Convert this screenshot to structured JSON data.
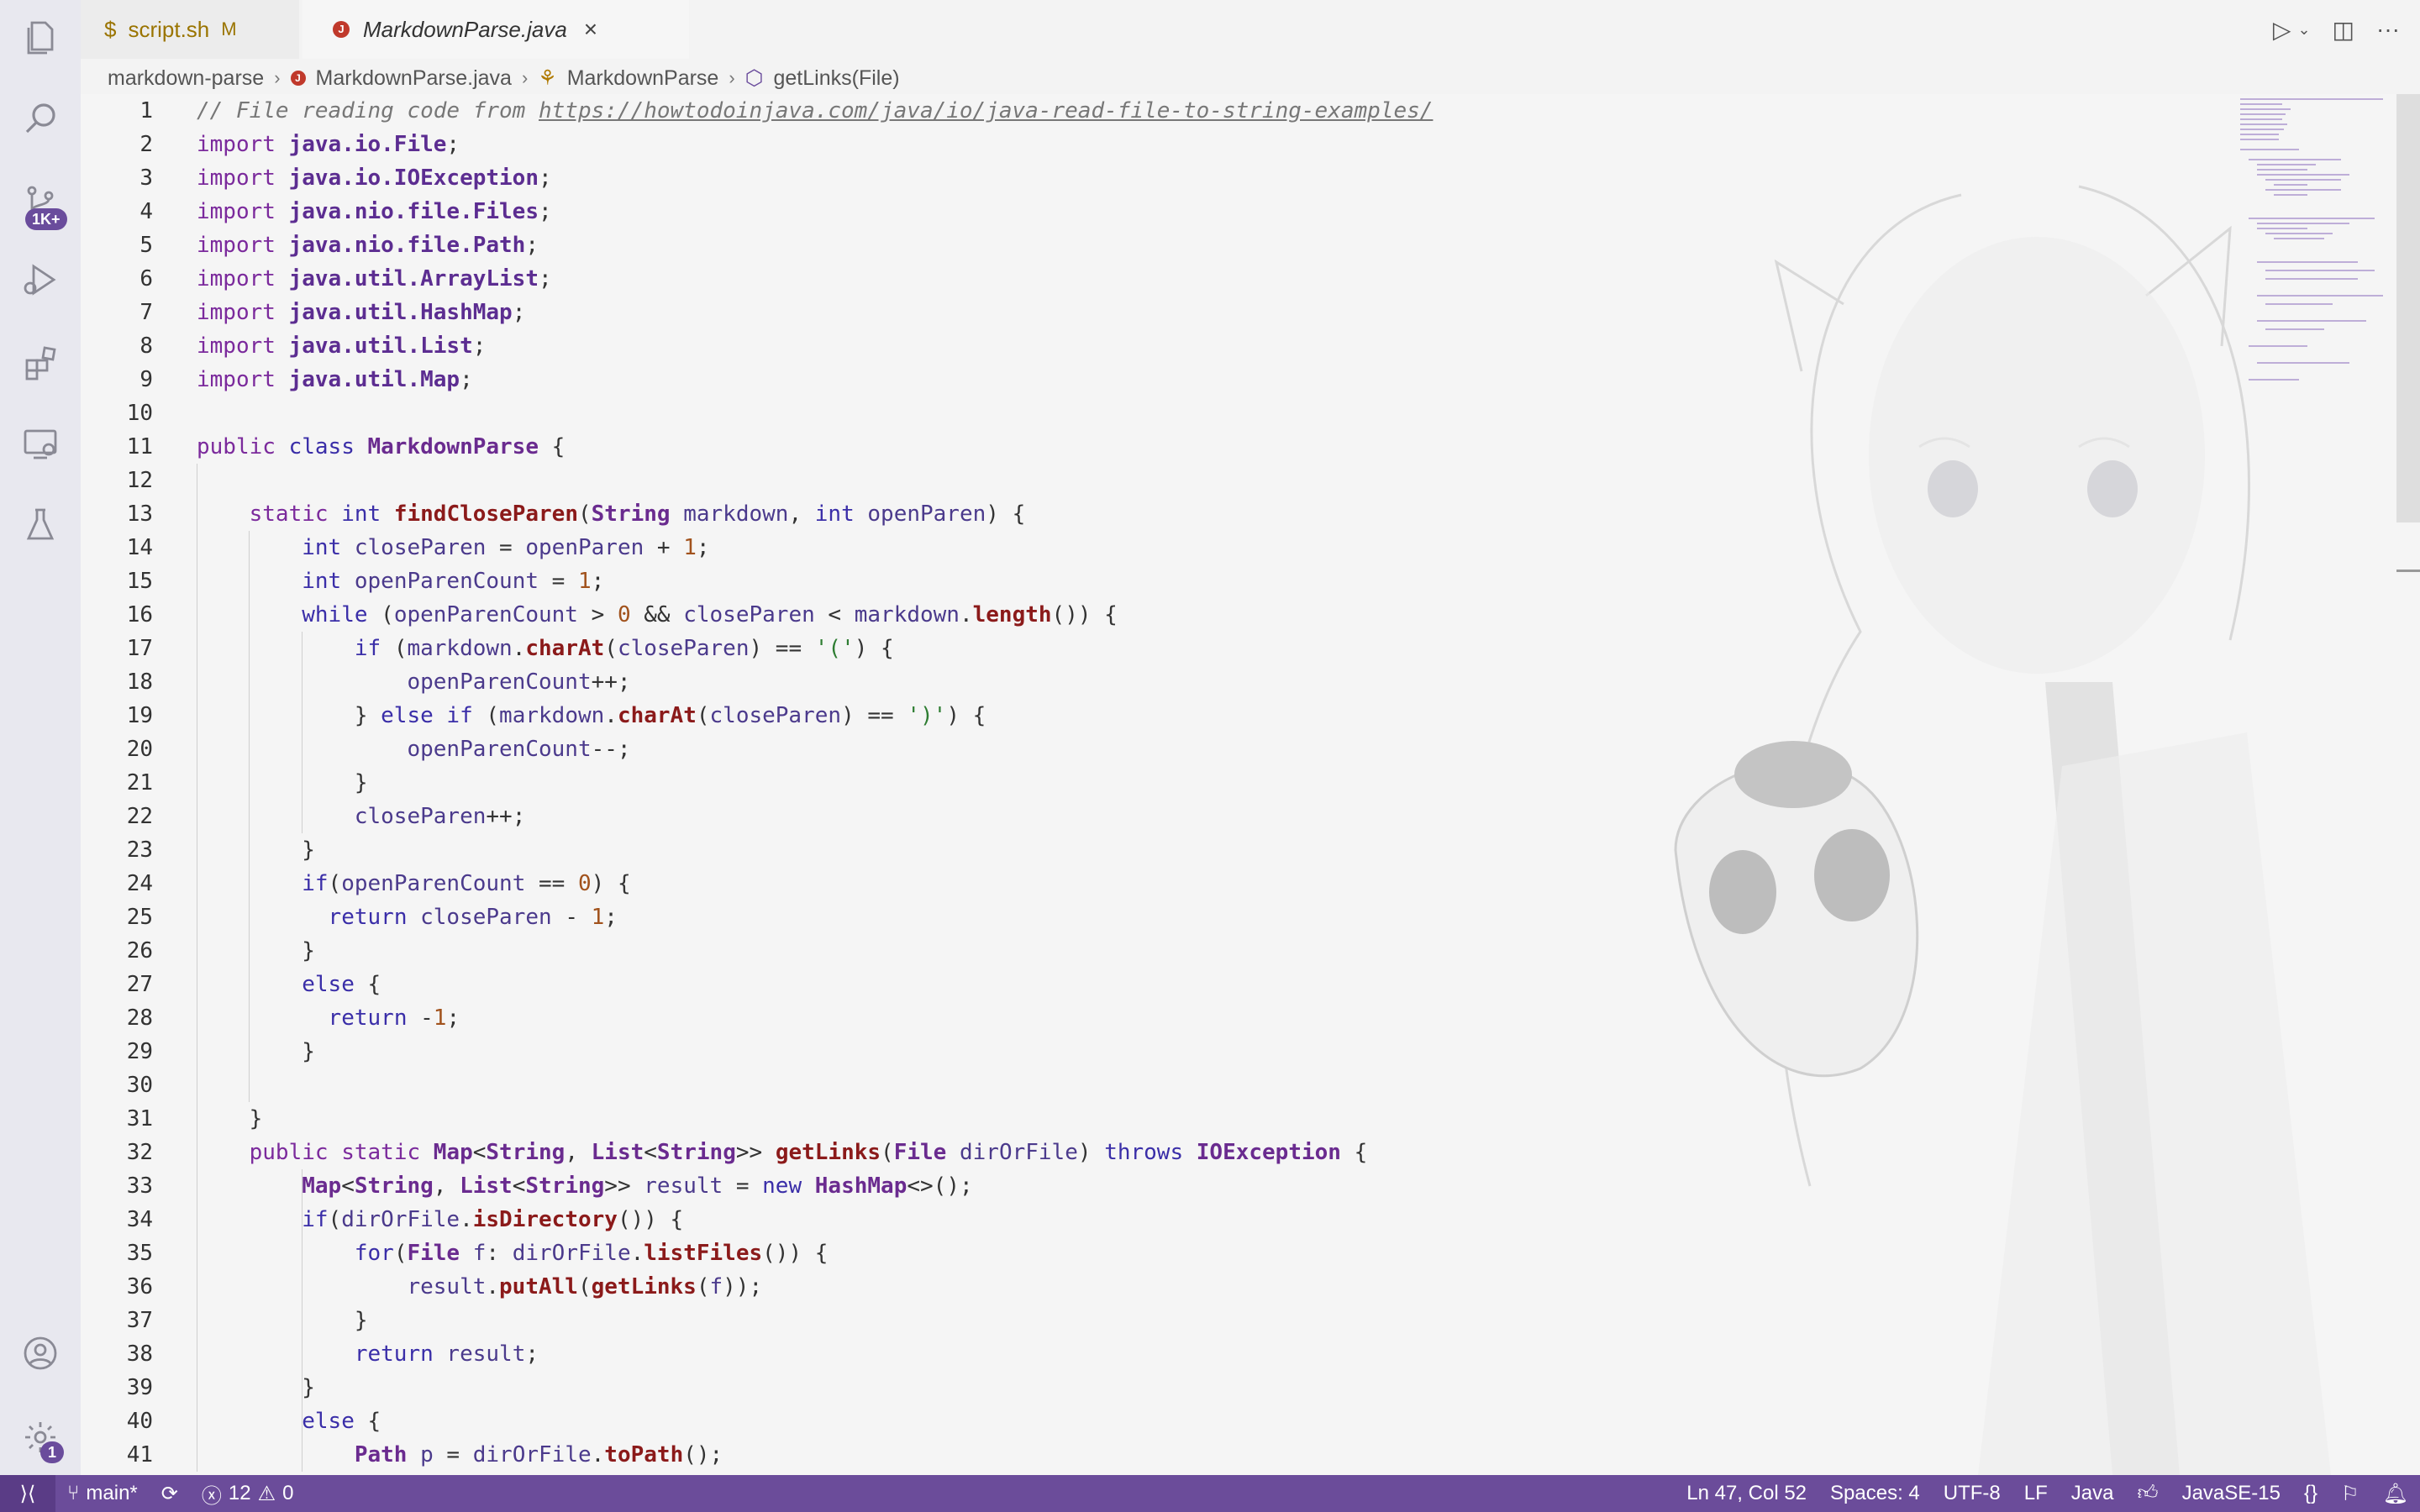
{
  "activity_bar": {
    "items": [
      {
        "name": "explorer-icon"
      },
      {
        "name": "search-icon"
      },
      {
        "name": "source-control-icon",
        "badge": "1K+"
      },
      {
        "name": "run-debug-icon"
      },
      {
        "name": "extensions-icon"
      },
      {
        "name": "remote-explorer-icon"
      },
      {
        "name": "testing-icon"
      }
    ],
    "bottom": [
      {
        "name": "accounts-icon"
      },
      {
        "name": "manage-gear-icon",
        "badge": "1"
      }
    ]
  },
  "tabs": [
    {
      "glyph": "$",
      "label": "script.sh",
      "modified": "M",
      "active": false
    },
    {
      "glyph": "J",
      "label": "MarkdownParse.java",
      "active": true
    }
  ],
  "breadcrumb": [
    "markdown-parse",
    "MarkdownParse.java",
    "MarkdownParse",
    "getLinks(File)"
  ],
  "code": {
    "start_line": 1,
    "lines": [
      [
        [
          "cm",
          "// File reading code from "
        ],
        [
          "cm lnk",
          "https://howtodoinjava.com/java/io/java-read-file-to-string-examples/"
        ]
      ],
      [
        [
          "kw2",
          "import "
        ],
        [
          "pkg",
          "java.io.File"
        ],
        [
          "",
          "; "
        ]
      ],
      [
        [
          "kw2",
          "import "
        ],
        [
          "pkg",
          "java.io.IOException"
        ],
        [
          "",
          ";"
        ]
      ],
      [
        [
          "kw2",
          "import "
        ],
        [
          "pkg",
          "java.nio.file.Files"
        ],
        [
          "",
          ";"
        ]
      ],
      [
        [
          "kw2",
          "import "
        ],
        [
          "pkg",
          "java.nio.file.Path"
        ],
        [
          "",
          ";"
        ]
      ],
      [
        [
          "kw2",
          "import "
        ],
        [
          "pkg",
          "java.util.ArrayList"
        ],
        [
          "",
          ";"
        ]
      ],
      [
        [
          "kw2",
          "import "
        ],
        [
          "pkg",
          "java.util.HashMap"
        ],
        [
          "",
          ";"
        ]
      ],
      [
        [
          "kw2",
          "import "
        ],
        [
          "pkg",
          "java.util.List"
        ],
        [
          "",
          ";"
        ]
      ],
      [
        [
          "kw2",
          "import "
        ],
        [
          "pkg",
          "java.util.Map"
        ],
        [
          "",
          ";"
        ]
      ],
      [],
      [
        [
          "kw2",
          "public "
        ],
        [
          "kw",
          "class "
        ],
        [
          "ty",
          "MarkdownParse"
        ],
        [
          "",
          " {"
        ]
      ],
      [],
      [
        [
          "",
          "    "
        ],
        [
          "kw2",
          "static "
        ],
        [
          "kw",
          "int "
        ],
        [
          "fn",
          "findCloseParen"
        ],
        [
          "",
          "("
        ],
        [
          "ty",
          "String"
        ],
        [
          "var",
          " markdown"
        ],
        [
          "",
          ", "
        ],
        [
          "kw",
          "int "
        ],
        [
          "var",
          "openParen"
        ],
        [
          "",
          ") {"
        ]
      ],
      [
        [
          "",
          "        "
        ],
        [
          "kw",
          "int "
        ],
        [
          "var",
          "closeParen"
        ],
        [
          "",
          " = "
        ],
        [
          "var",
          "openParen"
        ],
        [
          "",
          " + "
        ],
        [
          "num",
          "1"
        ],
        [
          "",
          ";"
        ]
      ],
      [
        [
          "",
          "        "
        ],
        [
          "kw",
          "int "
        ],
        [
          "var",
          "openParenCount"
        ],
        [
          "",
          " = "
        ],
        [
          "num",
          "1"
        ],
        [
          "",
          ";"
        ]
      ],
      [
        [
          "",
          "        "
        ],
        [
          "kw",
          "while "
        ],
        [
          "",
          "("
        ],
        [
          "var",
          "openParenCount"
        ],
        [
          "",
          " > "
        ],
        [
          "num",
          "0"
        ],
        [
          "",
          " && "
        ],
        [
          "var",
          "closeParen"
        ],
        [
          "",
          " < "
        ],
        [
          "var",
          "markdown"
        ],
        [
          "",
          "."
        ],
        [
          "fn",
          "length"
        ],
        [
          "",
          "()) {"
        ]
      ],
      [
        [
          "",
          "            "
        ],
        [
          "kw",
          "if "
        ],
        [
          "",
          "("
        ],
        [
          "var",
          "markdown"
        ],
        [
          "",
          "."
        ],
        [
          "fn",
          "charAt"
        ],
        [
          "",
          "("
        ],
        [
          "var",
          "closeParen"
        ],
        [
          "",
          ") == "
        ],
        [
          "str",
          "'('"
        ],
        [
          "",
          ") {"
        ]
      ],
      [
        [
          "",
          "                "
        ],
        [
          "var",
          "openParenCount"
        ],
        [
          "",
          "++;"
        ]
      ],
      [
        [
          "",
          "            } "
        ],
        [
          "kw",
          "else if "
        ],
        [
          "",
          "("
        ],
        [
          "var",
          "markdown"
        ],
        [
          "",
          "."
        ],
        [
          "fn",
          "charAt"
        ],
        [
          "",
          "("
        ],
        [
          "var",
          "closeParen"
        ],
        [
          "",
          ") == "
        ],
        [
          "str",
          "')'"
        ],
        [
          "",
          ") {"
        ]
      ],
      [
        [
          "",
          "                "
        ],
        [
          "var",
          "openParenCount"
        ],
        [
          "",
          "--;"
        ]
      ],
      [
        [
          "",
          "            }"
        ]
      ],
      [
        [
          "",
          "            "
        ],
        [
          "var",
          "closeParen"
        ],
        [
          "",
          "++;"
        ]
      ],
      [
        [
          "",
          "        }"
        ]
      ],
      [
        [
          "",
          "        "
        ],
        [
          "kw",
          "if"
        ],
        [
          "",
          "("
        ],
        [
          "var",
          "openParenCount"
        ],
        [
          "",
          " == "
        ],
        [
          "num",
          "0"
        ],
        [
          "",
          ") {"
        ]
      ],
      [
        [
          "",
          "          "
        ],
        [
          "kw",
          "return "
        ],
        [
          "var",
          "closeParen"
        ],
        [
          "",
          " - "
        ],
        [
          "num",
          "1"
        ],
        [
          "",
          ";"
        ]
      ],
      [
        [
          "",
          "        }"
        ]
      ],
      [
        [
          "",
          "        "
        ],
        [
          "kw",
          "else "
        ],
        [
          "",
          "{"
        ]
      ],
      [
        [
          "",
          "          "
        ],
        [
          "kw",
          "return "
        ],
        [
          "",
          "-"
        ],
        [
          "num",
          "1"
        ],
        [
          "",
          ";"
        ]
      ],
      [
        [
          "",
          "        }"
        ]
      ],
      [],
      [
        [
          "",
          "    }"
        ]
      ],
      [
        [
          "",
          "    "
        ],
        [
          "kw2",
          "public "
        ],
        [
          "kw2",
          "static "
        ],
        [
          "ty",
          "Map"
        ],
        [
          "",
          "<"
        ],
        [
          "ty",
          "String"
        ],
        [
          "",
          ", "
        ],
        [
          "ty",
          "List"
        ],
        [
          "",
          "<"
        ],
        [
          "ty",
          "String"
        ],
        [
          "",
          ">> "
        ],
        [
          "fn",
          "getLinks"
        ],
        [
          "",
          "("
        ],
        [
          "ty",
          "File"
        ],
        [
          "var",
          " dirOrFile"
        ],
        [
          "",
          ") "
        ],
        [
          "kw",
          "throws "
        ],
        [
          "ty",
          "IOException"
        ],
        [
          "",
          " {"
        ]
      ],
      [
        [
          "",
          "        "
        ],
        [
          "ty",
          "Map"
        ],
        [
          "",
          "<"
        ],
        [
          "ty",
          "String"
        ],
        [
          "",
          ", "
        ],
        [
          "ty",
          "List"
        ],
        [
          "",
          "<"
        ],
        [
          "ty",
          "String"
        ],
        [
          "",
          ">> "
        ],
        [
          "var",
          "result"
        ],
        [
          "",
          " = "
        ],
        [
          "kw",
          "new "
        ],
        [
          "ty",
          "HashMap"
        ],
        [
          "",
          "<>();"
        ]
      ],
      [
        [
          "",
          "        "
        ],
        [
          "kw",
          "if"
        ],
        [
          "",
          "("
        ],
        [
          "var",
          "dirOrFile"
        ],
        [
          "",
          "."
        ],
        [
          "fn",
          "isDirectory"
        ],
        [
          "",
          "()) {"
        ]
      ],
      [
        [
          "",
          "            "
        ],
        [
          "kw",
          "for"
        ],
        [
          "",
          "("
        ],
        [
          "ty",
          "File"
        ],
        [
          "var",
          " f"
        ],
        [
          "",
          ": "
        ],
        [
          "var",
          "dirOrFile"
        ],
        [
          "",
          "."
        ],
        [
          "fn",
          "listFiles"
        ],
        [
          "",
          "()) {"
        ]
      ],
      [
        [
          "",
          "                "
        ],
        [
          "var",
          "result"
        ],
        [
          "",
          "."
        ],
        [
          "fn",
          "putAll"
        ],
        [
          "",
          "("
        ],
        [
          "fn",
          "getLinks"
        ],
        [
          "",
          "("
        ],
        [
          "var",
          "f"
        ],
        [
          "",
          "));"
        ]
      ],
      [
        [
          "",
          "            }"
        ]
      ],
      [
        [
          "",
          "            "
        ],
        [
          "kw",
          "return "
        ],
        [
          "var",
          "result"
        ],
        [
          "",
          ";"
        ]
      ],
      [
        [
          "",
          "        }"
        ]
      ],
      [
        [
          "",
          "        "
        ],
        [
          "kw",
          "else "
        ],
        [
          "",
          "{"
        ]
      ],
      [
        [
          "",
          "            "
        ],
        [
          "ty",
          "Path"
        ],
        [
          "var",
          " p"
        ],
        [
          "",
          " = "
        ],
        [
          "var",
          "dirOrFile"
        ],
        [
          "",
          "."
        ],
        [
          "fn",
          "toPath"
        ],
        [
          "",
          "();"
        ]
      ]
    ]
  },
  "status_bar": {
    "branch": "main*",
    "errors": "12",
    "warnings": "0",
    "cursor": "Ln 47, Col 52",
    "spaces": "Spaces: 4",
    "encoding": "UTF-8",
    "eol": "LF",
    "language": "Java",
    "jdk": "JavaSE-15"
  },
  "colors": {
    "status_bar_bg": "#6b4c9a",
    "activity_bg": "#e8e8ef",
    "editor_bg": "#f5f5f5"
  }
}
